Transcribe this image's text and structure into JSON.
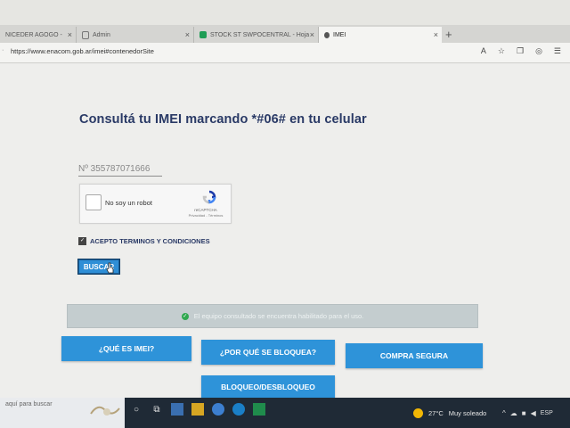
{
  "browser": {
    "tabs": [
      {
        "label": "NICEDER AGOGO -"
      },
      {
        "label": "Admin"
      },
      {
        "label": "STOCK ST SWPOCENTRAL - Hoja"
      },
      {
        "label": "IMEI"
      }
    ],
    "url": "https://www.enacom.gob.ar/imei#contenedorSite"
  },
  "page": {
    "title": "Consultá tu IMEI marcando *#06# en tu celular",
    "imei_value": "Nº 355787071666",
    "captcha": {
      "label": "No soy un robot",
      "brand": "reCAPTCHA",
      "links": "Privacidad - Términos"
    },
    "terms_label": "ACEPTO TERMINOS Y CONDICIONES",
    "search_button": "BUSCAR",
    "result_message": "El equipo consultado se encuentra habilitado para el uso.",
    "nav_buttons": {
      "que_es_imei": "¿QUÉ ES IMEI?",
      "por_que_bloquea": "¿POR QUÉ SE BLOQUEA?",
      "compra_segura": "COMPRA SEGURA",
      "bloqueo": "BLOQUEO/DESBLOQUEO"
    },
    "colors": {
      "title": "#2a3a66",
      "button": "#2e93d9",
      "result_bg": "#c4cdcf"
    }
  },
  "taskbar": {
    "search_placeholder": "aquí para buscar",
    "temperature": "27°C",
    "weather": "Muy soleado",
    "language": "ESP"
  }
}
